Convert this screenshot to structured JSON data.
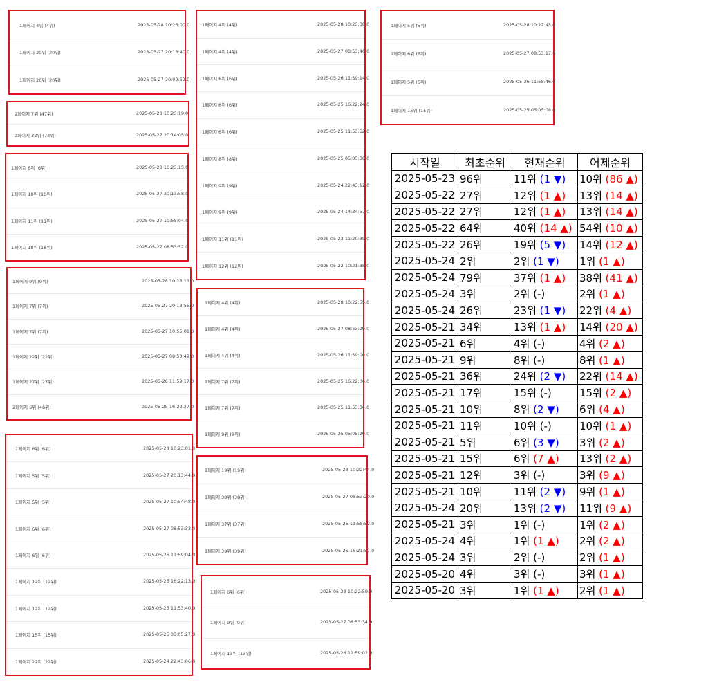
{
  "lists": [
    {
      "entries": [
        {
          "page": "1페이지 4위 (4위)",
          "time": "2025-05-28 10:23:00.0"
        },
        {
          "page": "1페이지 20위 (20위)",
          "time": "2025-05-27 20:13:40.0"
        },
        {
          "page": "1페이지 20위 (20위)",
          "time": "2025-05-27 20:09:52.0"
        }
      ]
    },
    {
      "entries": [
        {
          "page": "2페이지 7위 (47위)",
          "time": "2025-05-28 10:23:19.0"
        },
        {
          "page": "2페이지 32위 (72위)",
          "time": "2025-05-27 20:14:05.0"
        }
      ]
    },
    {
      "entries": [
        {
          "page": "1페이지 6위 (6위)",
          "time": "2025-05-28 10:23:15.0"
        },
        {
          "page": "1페이지 10위 (10위)",
          "time": "2025-05-27 20:13:58.0"
        },
        {
          "page": "1페이지 11위 (11위)",
          "time": "2025-05-27 10:55:04.0"
        },
        {
          "page": "1페이지 18위 (18위)",
          "time": "2025-05-27 08:53:52.0"
        }
      ]
    },
    {
      "entries": [
        {
          "page": "1페이지 9위 (9위)",
          "time": "2025-05-28 10:23:13.0"
        },
        {
          "page": "1페이지 7위 (7위)",
          "time": "2025-05-27 20:13:55.0"
        },
        {
          "page": "1페이지 7위 (7위)",
          "time": "2025-05-27 10:55:01.0"
        },
        {
          "page": "1페이지 22위 (22위)",
          "time": "2025-05-27 08:53:49.0"
        },
        {
          "page": "1페이지 27위 (27위)",
          "time": "2025-05-26 11:59:17.0"
        },
        {
          "page": "2페이지 6위 (46위)",
          "time": "2025-05-25 16:22:27.0"
        }
      ]
    },
    {
      "entries": [
        {
          "page": "1페이지 6위 (6위)",
          "time": "2025-05-28 10:23:01.0"
        },
        {
          "page": "1페이지 5위 (5위)",
          "time": "2025-05-27 20:13:44.0"
        },
        {
          "page": "1페이지 5위 (5위)",
          "time": "2025-05-27 10:54:48.0"
        },
        {
          "page": "1페이지 6위 (6위)",
          "time": "2025-05-27 08:53:33.0"
        },
        {
          "page": "1페이지 6위 (6위)",
          "time": "2025-05-26 11:59:04.0"
        },
        {
          "page": "1페이지 12위 (12위)",
          "time": "2025-05-25 16:22:13.0"
        },
        {
          "page": "1페이지 12위 (12위)",
          "time": "2025-05-25 11:53:40.0"
        },
        {
          "page": "1페이지 15위 (15위)",
          "time": "2025-05-25 05:05:27.0"
        },
        {
          "page": "1페이지 22위 (22위)",
          "time": "2025-05-24 22:43:06.0"
        }
      ]
    },
    {
      "entries": [
        {
          "page": "1페이지 4위 (4위)",
          "time": "2025-05-28 10:23:08.0"
        },
        {
          "page": "1페이지 4위 (4위)",
          "time": "2025-05-27 08:53:46.0"
        },
        {
          "page": "1페이지 6위 (6위)",
          "time": "2025-05-26 11:59:14.0"
        },
        {
          "page": "1페이지 6위 (6위)",
          "time": "2025-05-25 16:22:24.0"
        },
        {
          "page": "1페이지 6위 (6위)",
          "time": "2025-05-25 11:53:52.0"
        },
        {
          "page": "1페이지 8위 (8위)",
          "time": "2025-05-25 05:05:36.0"
        },
        {
          "page": "1페이지 9위 (9위)",
          "time": "2025-05-24 22:43:12.0"
        },
        {
          "page": "1페이지 9위 (9위)",
          "time": "2025-05-24 14:34:57.0"
        },
        {
          "page": "1페이지 11위 (11위)",
          "time": "2025-05-23 11:20:39.0"
        },
        {
          "page": "1페이지 12위 (12위)",
          "time": "2025-05-22 10:21:38.0"
        }
      ]
    },
    {
      "entries": [
        {
          "page": "1페이지 4위 (4위)",
          "time": "2025-05-28 10:22:55.0"
        },
        {
          "page": "1페이지 4위 (4위)",
          "time": "2025-05-27 08:53:29.0"
        },
        {
          "page": "1페이지 4위 (4위)",
          "time": "2025-05-26 11:59:00.0"
        },
        {
          "page": "1페이지 7위 (7위)",
          "time": "2025-05-25 16:22:06.0"
        },
        {
          "page": "1페이지 7위 (7위)",
          "time": "2025-05-25 11:53:34.0"
        },
        {
          "page": "1페이지 9위 (9위)",
          "time": "2025-05-25 05:05:20.0"
        }
      ]
    },
    {
      "entries": [
        {
          "page": "1페이지 19위 (19위)",
          "time": "2025-05-28 10:22:44.0"
        },
        {
          "page": "1페이지 38위 (38위)",
          "time": "2025-05-27 08:53:20.0"
        },
        {
          "page": "1페이지 37위 (37위)",
          "time": "2025-05-26 11:58:52.0"
        },
        {
          "page": "1페이지 39위 (39위)",
          "time": "2025-05-25 16:21:57.0"
        }
      ]
    },
    {
      "entries": [
        {
          "page": "1페이지 6위 (6위)",
          "time": "2025-05-28 10:22:59.0"
        },
        {
          "page": "1페이지 9위 (9위)",
          "time": "2025-05-27 08:53:34.0"
        },
        {
          "page": "1페이지 13위 (13위)",
          "time": "2025-05-26 11:59:02.0"
        }
      ]
    },
    {
      "entries": [
        {
          "page": "1페이지 5위 (5위)",
          "time": "2025-05-28 10:22:45.0"
        },
        {
          "page": "1페이지 6위 (6위)",
          "time": "2025-05-27 08:53:17.0"
        },
        {
          "page": "1페이지 5위 (5위)",
          "time": "2025-05-26 11:58:46.0"
        },
        {
          "page": "1페이지 15위 (15위)",
          "time": "2025-05-25 05:05:08.0"
        }
      ]
    }
  ],
  "rank_table": {
    "headers": [
      "시작일",
      "최초순위",
      "현재순위",
      "어제순위"
    ],
    "rows": [
      {
        "start": "2025-05-23",
        "first": "96위",
        "current": "11위",
        "current_change": "(1 ▼)",
        "current_dir": "down",
        "yesterday": "10위",
        "yesterday_change": "(86 ▲)",
        "yesterday_dir": "up"
      },
      {
        "start": "2025-05-22",
        "first": "27위",
        "current": "12위",
        "current_change": "(1 ▲)",
        "current_dir": "up",
        "yesterday": "13위",
        "yesterday_change": "(14 ▲)",
        "yesterday_dir": "up"
      },
      {
        "start": "2025-05-22",
        "first": "27위",
        "current": "12위",
        "current_change": "(1 ▲)",
        "current_dir": "up",
        "yesterday": "13위",
        "yesterday_change": "(14 ▲)",
        "yesterday_dir": "up"
      },
      {
        "start": "2025-05-22",
        "first": "64위",
        "current": "40위",
        "current_change": "(14 ▲)",
        "current_dir": "up",
        "yesterday": "54위",
        "yesterday_change": "(10 ▲)",
        "yesterday_dir": "up"
      },
      {
        "start": "2025-05-22",
        "first": "26위",
        "current": "19위",
        "current_change": "(5 ▼)",
        "current_dir": "down",
        "yesterday": "14위",
        "yesterday_change": "(12 ▲)",
        "yesterday_dir": "up"
      },
      {
        "start": "2025-05-24",
        "first": "2위",
        "current": "2위",
        "current_change": "(1 ▼)",
        "current_dir": "down",
        "yesterday": "1위",
        "yesterday_change": "(1 ▲)",
        "yesterday_dir": "up"
      },
      {
        "start": "2025-05-24",
        "first": "79위",
        "current": "37위",
        "current_change": "(1 ▲)",
        "current_dir": "up",
        "yesterday": "38위",
        "yesterday_change": "(41 ▲)",
        "yesterday_dir": "up"
      },
      {
        "start": "2025-05-24",
        "first": "3위",
        "current": "2위",
        "current_change": "(-)",
        "current_dir": "same",
        "yesterday": "2위",
        "yesterday_change": "(1 ▲)",
        "yesterday_dir": "up"
      },
      {
        "start": "2025-05-24",
        "first": "26위",
        "current": "23위",
        "current_change": "(1 ▼)",
        "current_dir": "down",
        "yesterday": "22위",
        "yesterday_change": "(4 ▲)",
        "yesterday_dir": "up"
      },
      {
        "start": "2025-05-21",
        "first": "34위",
        "current": "13위",
        "current_change": "(1 ▲)",
        "current_dir": "up",
        "yesterday": "14위",
        "yesterday_change": "(20 ▲)",
        "yesterday_dir": "up"
      },
      {
        "start": "2025-05-21",
        "first": "6위",
        "current": "4위",
        "current_change": "(-)",
        "current_dir": "same",
        "yesterday": "4위",
        "yesterday_change": "(2 ▲)",
        "yesterday_dir": "up"
      },
      {
        "start": "2025-05-21",
        "first": "9위",
        "current": "8위",
        "current_change": "(-)",
        "current_dir": "same",
        "yesterday": "8위",
        "yesterday_change": "(1 ▲)",
        "yesterday_dir": "up"
      },
      {
        "start": "2025-05-21",
        "first": "36위",
        "current": "24위",
        "current_change": "(2 ▼)",
        "current_dir": "down",
        "yesterday": "22위",
        "yesterday_change": "(14 ▲)",
        "yesterday_dir": "up"
      },
      {
        "start": "2025-05-21",
        "first": "17위",
        "current": "15위",
        "current_change": "(-)",
        "current_dir": "same",
        "yesterday": "15위",
        "yesterday_change": "(2 ▲)",
        "yesterday_dir": "up"
      },
      {
        "start": "2025-05-21",
        "first": "10위",
        "current": "8위",
        "current_change": "(2 ▼)",
        "current_dir": "down",
        "yesterday": "6위",
        "yesterday_change": "(4 ▲)",
        "yesterday_dir": "up"
      },
      {
        "start": "2025-05-21",
        "first": "11위",
        "current": "10위",
        "current_change": "(-)",
        "current_dir": "same",
        "yesterday": "10위",
        "yesterday_change": "(1 ▲)",
        "yesterday_dir": "up"
      },
      {
        "start": "2025-05-21",
        "first": "5위",
        "current": "6위",
        "current_change": "(3 ▼)",
        "current_dir": "down",
        "yesterday": "3위",
        "yesterday_change": "(2 ▲)",
        "yesterday_dir": "up"
      },
      {
        "start": "2025-05-21",
        "first": "15위",
        "current": "6위",
        "current_change": "(7 ▲)",
        "current_dir": "up",
        "yesterday": "13위",
        "yesterday_change": "(2 ▲)",
        "yesterday_dir": "up"
      },
      {
        "start": "2025-05-21",
        "first": "12위",
        "current": "3위",
        "current_change": "(-)",
        "current_dir": "same",
        "yesterday": "3위",
        "yesterday_change": "(9 ▲)",
        "yesterday_dir": "up"
      },
      {
        "start": "2025-05-21",
        "first": "10위",
        "current": "11위",
        "current_change": "(2 ▼)",
        "current_dir": "down",
        "yesterday": "9위",
        "yesterday_change": "(1 ▲)",
        "yesterday_dir": "up"
      },
      {
        "start": "2025-05-24",
        "first": "20위",
        "current": "13위",
        "current_change": "(2 ▼)",
        "current_dir": "down",
        "yesterday": "11위",
        "yesterday_change": "(9 ▲)",
        "yesterday_dir": "up"
      },
      {
        "start": "2025-05-21",
        "first": "3위",
        "current": "1위",
        "current_change": "(-)",
        "current_dir": "same",
        "yesterday": "1위",
        "yesterday_change": "(2 ▲)",
        "yesterday_dir": "up"
      },
      {
        "start": "2025-05-24",
        "first": "4위",
        "current": "1위",
        "current_change": "(1 ▲)",
        "current_dir": "up",
        "yesterday": "2위",
        "yesterday_change": "(2 ▲)",
        "yesterday_dir": "up"
      },
      {
        "start": "2025-05-24",
        "first": "3위",
        "current": "2위",
        "current_change": "(-)",
        "current_dir": "same",
        "yesterday": "2위",
        "yesterday_change": "(1 ▲)",
        "yesterday_dir": "up"
      },
      {
        "start": "2025-05-20",
        "first": "4위",
        "current": "3위",
        "current_change": "(-)",
        "current_dir": "same",
        "yesterday": "3위",
        "yesterday_change": "(1 ▲)",
        "yesterday_dir": "up"
      },
      {
        "start": "2025-05-20",
        "first": "3위",
        "current": "1위",
        "current_change": "(1 ▲)",
        "current_dir": "up",
        "yesterday": "2위",
        "yesterday_change": "(1 ▲)",
        "yesterday_dir": "up"
      }
    ]
  },
  "colors": {
    "border_red": "#e0141e",
    "up": "#ff0000",
    "down": "#0000ff"
  }
}
